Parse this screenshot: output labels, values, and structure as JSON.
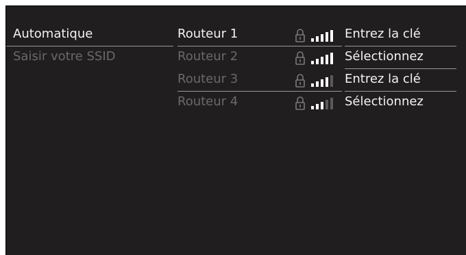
{
  "left_menu": {
    "items": [
      {
        "label": "Automatique",
        "active": true
      },
      {
        "label": "Saisir votre SSID",
        "active": false
      }
    ]
  },
  "routers": [
    {
      "name": "Routeur 1",
      "status": "Entrez la clé",
      "signal_bars": 5,
      "locked": true,
      "active": true,
      "line_under_name": true,
      "line_under_status": true
    },
    {
      "name": "Routeur 2",
      "status": "Sélectionnez",
      "signal_bars": 5,
      "locked": true,
      "active": false,
      "line_under_name": false,
      "line_under_status": true
    },
    {
      "name": "Routeur 3",
      "status": "Entrez la clé",
      "signal_bars": 4,
      "locked": true,
      "active": false,
      "line_under_name": true,
      "line_under_status": true
    },
    {
      "name": "Routeur 4",
      "status": "Sélectionnez",
      "signal_bars": 3,
      "locked": true,
      "active": false,
      "line_under_name": false,
      "line_under_status": false
    }
  ],
  "icons": {
    "lock": "lock-icon",
    "signal": "wifi-signal-icon"
  },
  "colors": {
    "background": "#211e1f",
    "text_active": "#f3f3f3",
    "text_inactive": "#6a6a6a",
    "bar_on": "#ffffff",
    "bar_off": "#5a5a5a",
    "divider": "#9a9a9a"
  }
}
